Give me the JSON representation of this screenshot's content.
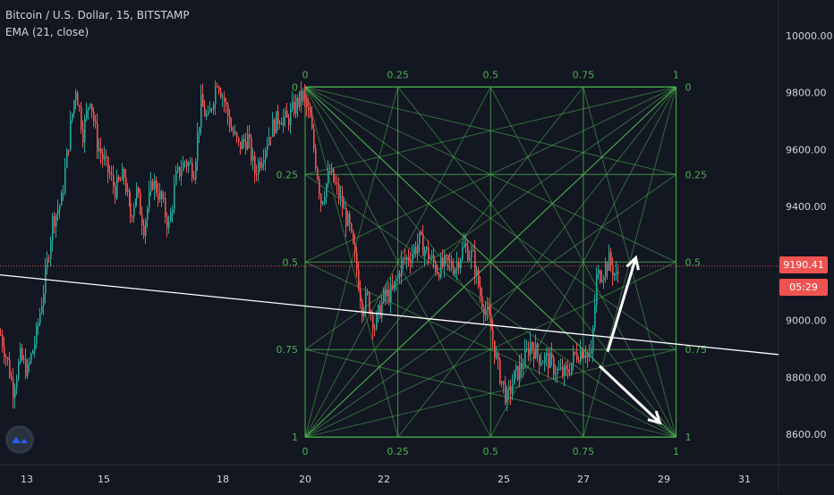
{
  "legend": {
    "title": "Bitcoin / U.S. Dollar, 15, BITSTAMP",
    "indicator": "EMA (21, close)"
  },
  "price_badge": {
    "value": "9190.41",
    "color": "#ef5350"
  },
  "timer_badge": {
    "value": "05:29",
    "color": "#ef5350"
  },
  "colors": {
    "background": "#131722",
    "up": "#26a69a",
    "down": "#ef5350",
    "grid": "#4caf50",
    "trendline": "#ffffff",
    "axis_text": "#d1d4dc"
  },
  "icons": {
    "logo": "tradingview-logo-icon"
  },
  "chart_data": {
    "type": "candlestick",
    "ylim": [
      8520,
      10110
    ],
    "yticks": [
      10000,
      9800,
      9600,
      9400,
      9200,
      9000,
      8800,
      8600
    ],
    "ytick_labels": [
      "10000.00",
      "9800.00",
      "9600.00",
      "9400.00",
      "9200.00",
      "9000.00",
      "8800.00",
      "8600.00"
    ],
    "xticks": [
      "13",
      "15",
      "18",
      "20",
      "22",
      "25",
      "27",
      "29",
      "31"
    ],
    "current_price": 9190.41,
    "path": [
      [
        0,
        8950
      ],
      [
        8,
        8850
      ],
      [
        14,
        8760
      ],
      [
        22,
        8870
      ],
      [
        30,
        8820
      ],
      [
        40,
        8950
      ],
      [
        50,
        9150
      ],
      [
        58,
        9350
      ],
      [
        68,
        9420
      ],
      [
        78,
        9680
      ],
      [
        84,
        9820
      ],
      [
        92,
        9660
      ],
      [
        100,
        9790
      ],
      [
        108,
        9620
      ],
      [
        118,
        9540
      ],
      [
        128,
        9460
      ],
      [
        138,
        9510
      ],
      [
        145,
        9370
      ],
      [
        152,
        9450
      ],
      [
        160,
        9330
      ],
      [
        170,
        9490
      ],
      [
        180,
        9420
      ],
      [
        188,
        9330
      ],
      [
        196,
        9500
      ],
      [
        206,
        9560
      ],
      [
        216,
        9530
      ],
      [
        224,
        9760
      ],
      [
        232,
        9700
      ],
      [
        242,
        9850
      ],
      [
        250,
        9770
      ],
      [
        258,
        9670
      ],
      [
        266,
        9610
      ],
      [
        276,
        9640
      ],
      [
        284,
        9520
      ],
      [
        292,
        9580
      ],
      [
        302,
        9670
      ],
      [
        312,
        9720
      ],
      [
        320,
        9700
      ],
      [
        330,
        9760
      ],
      [
        338,
        9790
      ],
      [
        346,
        9700
      ],
      [
        352,
        9560
      ],
      [
        358,
        9420
      ],
      [
        368,
        9520
      ],
      [
        378,
        9440
      ],
      [
        390,
        9320
      ],
      [
        398,
        9180
      ],
      [
        404,
        9050
      ],
      [
        410,
        9080
      ],
      [
        418,
        8980
      ],
      [
        428,
        9080
      ],
      [
        438,
        9100
      ],
      [
        448,
        9200
      ],
      [
        458,
        9230
      ],
      [
        468,
        9280
      ],
      [
        478,
        9230
      ],
      [
        488,
        9180
      ],
      [
        498,
        9200
      ],
      [
        508,
        9190
      ],
      [
        518,
        9260
      ],
      [
        528,
        9220
      ],
      [
        536,
        9090
      ],
      [
        546,
        9000
      ],
      [
        556,
        8830
      ],
      [
        566,
        8720
      ],
      [
        574,
        8800
      ],
      [
        584,
        8850
      ],
      [
        592,
        8920
      ],
      [
        602,
        8870
      ],
      [
        612,
        8860
      ],
      [
        622,
        8820
      ],
      [
        632,
        8810
      ],
      [
        642,
        8880
      ],
      [
        652,
        8900
      ],
      [
        660,
        8870
      ],
      [
        666,
        9150
      ],
      [
        674,
        9180
      ],
      [
        680,
        9210
      ],
      [
        688,
        9150
      ],
      [
        692,
        9180
      ]
    ],
    "trendline": {
      "start": [
        0,
        9160
      ],
      "end": [
        870,
        8880
      ]
    },
    "fib_box": {
      "x_start": 20,
      "x_end": 29.3,
      "y_top": 9820,
      "y_bottom": 8590,
      "levels": [
        "0",
        "0.25",
        "0.5",
        "0.75",
        "1"
      ]
    },
    "arrows": [
      {
        "from": [
          27.6,
          8890
        ],
        "to": [
          28.3,
          9220
        ]
      },
      {
        "from": [
          27.4,
          8840
        ],
        "to": [
          28.9,
          8640
        ]
      }
    ],
    "xlabel": "",
    "ylabel": ""
  }
}
